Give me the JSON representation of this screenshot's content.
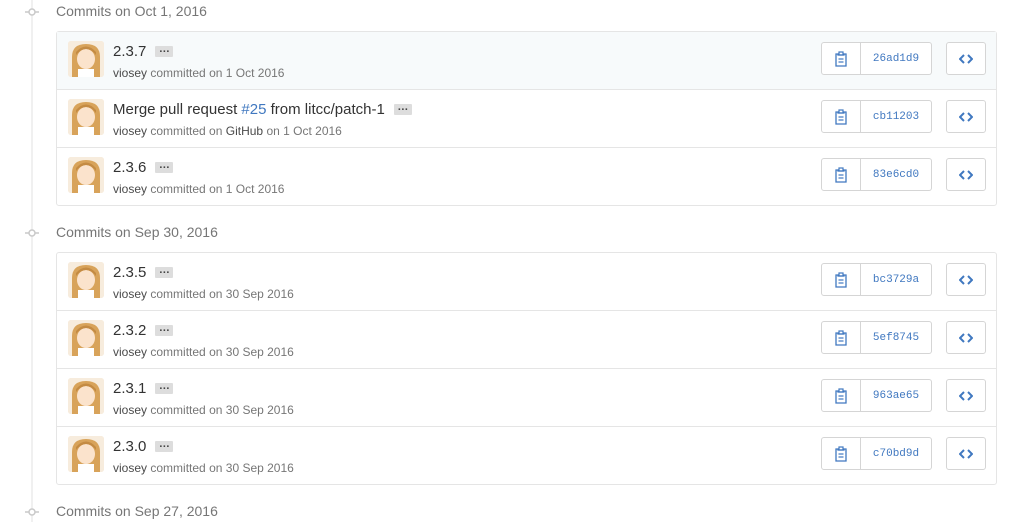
{
  "groups": [
    {
      "title": "Commits on Oct 1, 2016",
      "commits": [
        {
          "message": "2.3.7",
          "author": "viosey",
          "action": "committed",
          "on_label": "on",
          "date": "1 Oct 2016",
          "sha": "26ad1d9",
          "highlight": true
        },
        {
          "message_prefix": "Merge pull request ",
          "pr_link": "#25",
          "message_suffix": " from litcc/patch-1",
          "author": "viosey",
          "action": "committed on",
          "via": "GitHub",
          "on_label": "on",
          "date": "1 Oct 2016",
          "sha": "cb11203"
        },
        {
          "message": "2.3.6",
          "author": "viosey",
          "action": "committed",
          "on_label": "on",
          "date": "1 Oct 2016",
          "sha": "83e6cd0"
        }
      ]
    },
    {
      "title": "Commits on Sep 30, 2016",
      "commits": [
        {
          "message": "2.3.5",
          "author": "viosey",
          "action": "committed",
          "on_label": "on",
          "date": "30 Sep 2016",
          "sha": "bc3729a"
        },
        {
          "message": "2.3.2",
          "author": "viosey",
          "action": "committed",
          "on_label": "on",
          "date": "30 Sep 2016",
          "sha": "5ef8745"
        },
        {
          "message": "2.3.1",
          "author": "viosey",
          "action": "committed",
          "on_label": "on",
          "date": "30 Sep 2016",
          "sha": "963ae65"
        },
        {
          "message": "2.3.0",
          "author": "viosey",
          "action": "committed",
          "on_label": "on",
          "date": "30 Sep 2016",
          "sha": "c70bd9d"
        }
      ]
    },
    {
      "title": "Commits on Sep 27, 2016",
      "commits": []
    }
  ],
  "ellipsis_label": "…",
  "icons": {
    "clipboard": "clipboard-icon",
    "browse": "code-icon",
    "timeline": "git-commit-icon"
  },
  "colors": {
    "link": "#4078c0",
    "muted": "#767676",
    "border": "#e5e5e5"
  }
}
